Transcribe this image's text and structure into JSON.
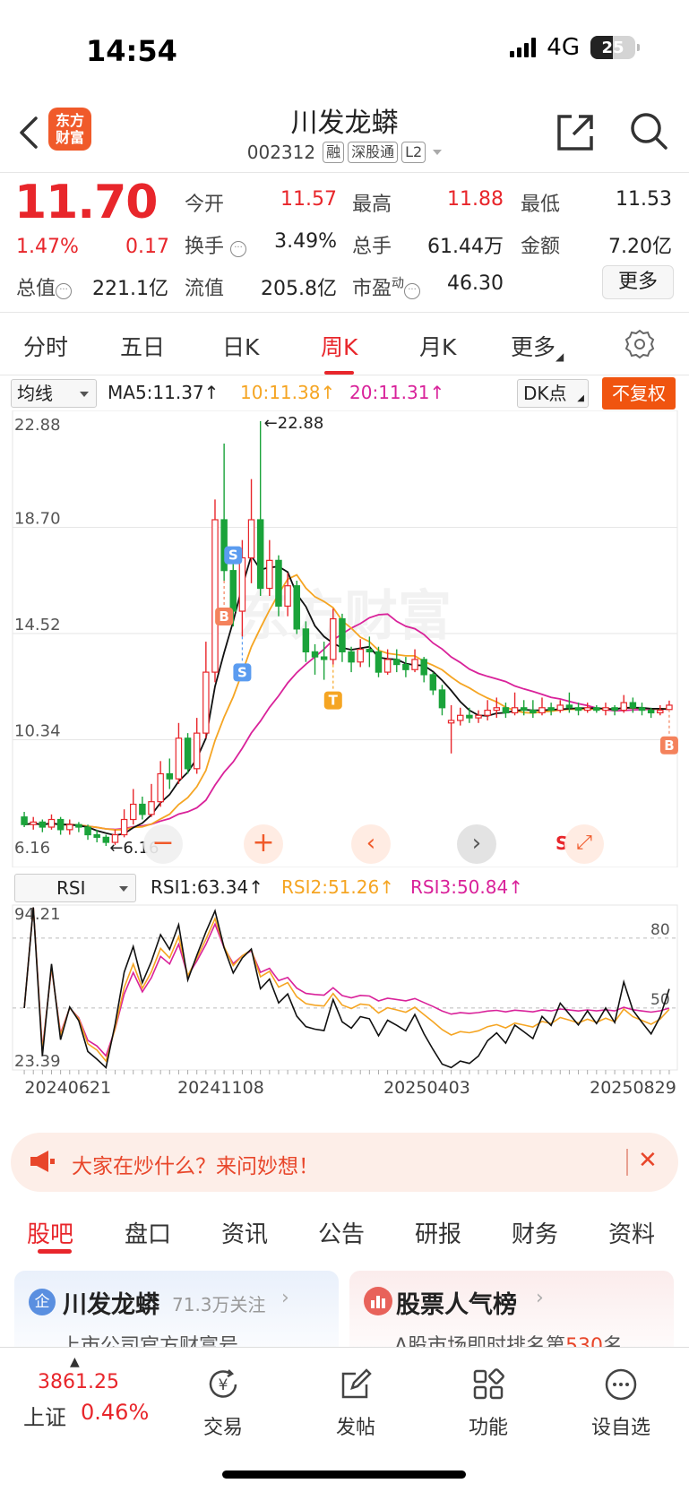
{
  "status_bar": {
    "time": "14:54",
    "network": "4G",
    "battery": "25"
  },
  "header": {
    "logo_line1": "东方",
    "logo_line2": "财富",
    "title": "川发龙蟒",
    "code": "002312",
    "tags": [
      "融",
      "深股通",
      "L2"
    ]
  },
  "quote": {
    "price": "11.70",
    "change_pct": "1.47%",
    "change": "0.17",
    "stats": [
      {
        "label": "今开",
        "value": "11.57",
        "color": "red"
      },
      {
        "label": "最高",
        "value": "11.88",
        "color": "red"
      },
      {
        "label": "最低",
        "value": "11.53",
        "color": "black"
      },
      {
        "label": "换手",
        "value": "3.49%",
        "color": "black"
      },
      {
        "label": "总手",
        "value": "61.44万",
        "color": "black"
      },
      {
        "label": "金额",
        "value": "7.20亿",
        "color": "black"
      },
      {
        "label": "总值",
        "value": "221.1亿",
        "color": "black"
      },
      {
        "label": "流值",
        "value": "205.8亿",
        "color": "black"
      },
      {
        "label": "市盈",
        "label_sup": "动",
        "value": "46.30",
        "color": "black"
      }
    ],
    "more_button": "更多"
  },
  "chart_tabs": [
    "分时",
    "五日",
    "日K",
    "周K",
    "月K",
    "更多"
  ],
  "chart_tab_active": "周K",
  "kline_legend": {
    "indicator_select": "均线",
    "ma5": "MA5:11.37↑",
    "ma10": "10:11.38↑",
    "ma20": "20:11.31↑",
    "dk_select": "DK点",
    "adjust_button": "不复权"
  },
  "rsi_legend": {
    "indicator_select": "RSI",
    "rsi1": "RSI1:63.34↑",
    "rsi2": "RSI2:51.26↑",
    "rsi3": "RSI3:50.84↑"
  },
  "chart_data": [
    {
      "type": "candlestick",
      "y_ticks": [
        "22.88",
        "18.70",
        "14.52",
        "10.34",
        "6.16"
      ],
      "ylim": [
        6.16,
        22.88
      ],
      "max_label": "22.88",
      "min_label": "6.16",
      "markers": [
        "B",
        "S",
        "S",
        "T",
        "B",
        "S"
      ],
      "colors": {
        "up": "#e8262b",
        "down": "#1aa33a",
        "ma5": "#111111",
        "ma10": "#f5a523",
        "ma20": "#d9229a"
      },
      "candles": [
        [
          7.3,
          7.0,
          7.5,
          6.9
        ],
        [
          7.0,
          7.1,
          7.3,
          6.8
        ],
        [
          7.1,
          6.9,
          7.2,
          6.7
        ],
        [
          6.9,
          7.2,
          7.4,
          6.8
        ],
        [
          7.2,
          6.8,
          7.3,
          6.6
        ],
        [
          6.8,
          7.0,
          7.2,
          6.6
        ],
        [
          7.0,
          6.9,
          7.1,
          6.7
        ],
        [
          6.9,
          6.6,
          7.0,
          6.4
        ],
        [
          6.6,
          6.5,
          6.8,
          6.3
        ],
        [
          6.5,
          6.3,
          6.6,
          6.16
        ],
        [
          6.3,
          6.6,
          6.8,
          6.2
        ],
        [
          6.6,
          7.2,
          7.6,
          6.5
        ],
        [
          7.2,
          7.8,
          8.4,
          7.0
        ],
        [
          7.8,
          7.4,
          8.1,
          7.2
        ],
        [
          7.4,
          7.9,
          8.6,
          7.3
        ],
        [
          7.9,
          9.0,
          9.5,
          7.7
        ],
        [
          9.0,
          8.8,
          9.6,
          8.4
        ],
        [
          8.8,
          10.4,
          11.0,
          8.6
        ],
        [
          10.4,
          9.2,
          10.6,
          9.0
        ],
        [
          9.2,
          10.6,
          11.2,
          9.0
        ],
        [
          10.6,
          13.0,
          14.2,
          10.4
        ],
        [
          13.0,
          19.0,
          19.8,
          12.6
        ],
        [
          19.0,
          17.0,
          22.0,
          16.6
        ],
        [
          17.0,
          15.4,
          17.6,
          14.8
        ],
        [
          15.4,
          17.5,
          18.2,
          14.4
        ],
        [
          17.5,
          19.0,
          20.6,
          16.5
        ],
        [
          19.0,
          16.3,
          22.88,
          16.0
        ],
        [
          16.3,
          17.4,
          18.2,
          16.0
        ],
        [
          17.4,
          15.6,
          17.6,
          15.2
        ],
        [
          15.6,
          16.4,
          16.9,
          15.2
        ],
        [
          16.4,
          14.7,
          16.6,
          14.5
        ],
        [
          14.7,
          13.8,
          15.0,
          13.4
        ],
        [
          13.8,
          13.6,
          14.1,
          12.9
        ],
        [
          13.6,
          13.5,
          14.2,
          12.7
        ],
        [
          13.5,
          15.1,
          15.5,
          13.3
        ],
        [
          15.1,
          13.8,
          15.3,
          13.4
        ],
        [
          13.8,
          13.4,
          14.0,
          13.0
        ],
        [
          13.4,
          13.9,
          14.3,
          13.2
        ],
        [
          13.9,
          13.8,
          14.4,
          13.2
        ],
        [
          13.8,
          13.0,
          14.0,
          12.8
        ],
        [
          13.0,
          13.5,
          13.9,
          12.9
        ],
        [
          13.5,
          13.3,
          13.9,
          13.0
        ],
        [
          13.3,
          13.1,
          13.6,
          12.8
        ],
        [
          13.1,
          13.5,
          13.9,
          13.0
        ],
        [
          13.5,
          12.9,
          13.6,
          12.6
        ],
        [
          12.9,
          12.3,
          13.0,
          12.1
        ],
        [
          12.3,
          11.6,
          12.5,
          11.3
        ],
        [
          11.0,
          11.1,
          11.7,
          9.8
        ],
        [
          11.1,
          11.3,
          11.6,
          10.9
        ],
        [
          11.3,
          11.2,
          11.6,
          11.0
        ],
        [
          11.2,
          11.3,
          11.5,
          11.0
        ],
        [
          11.3,
          11.5,
          11.9,
          11.1
        ],
        [
          11.5,
          11.6,
          12.0,
          11.2
        ],
        [
          11.6,
          11.4,
          11.8,
          11.2
        ],
        [
          11.4,
          11.6,
          12.2,
          11.3
        ],
        [
          11.6,
          11.5,
          11.9,
          11.3
        ],
        [
          11.5,
          11.4,
          11.9,
          11.2
        ],
        [
          11.4,
          11.6,
          12.0,
          11.3
        ],
        [
          11.6,
          11.5,
          11.8,
          11.3
        ],
        [
          11.5,
          11.7,
          11.9,
          11.4
        ],
        [
          11.7,
          11.6,
          12.2,
          11.4
        ],
        [
          11.6,
          11.5,
          11.8,
          11.3
        ],
        [
          11.5,
          11.6,
          11.8,
          11.4
        ],
        [
          11.6,
          11.5,
          11.7,
          11.4
        ],
        [
          11.5,
          11.6,
          11.8,
          11.3
        ],
        [
          11.6,
          11.5,
          11.7,
          11.3
        ],
        [
          11.5,
          11.8,
          12.1,
          11.4
        ],
        [
          11.8,
          11.6,
          12.0,
          11.4
        ],
        [
          11.6,
          11.5,
          11.8,
          11.3
        ],
        [
          11.5,
          11.4,
          11.6,
          11.2
        ],
        [
          11.4,
          11.5,
          11.7,
          11.3
        ],
        [
          11.53,
          11.7,
          11.88,
          11.53
        ]
      ]
    },
    {
      "type": "line",
      "name": "RSI",
      "y_ticks": [
        "94.21",
        "23.39"
      ],
      "ylim": [
        23.39,
        94.21
      ],
      "ref_lines": [
        80,
        50
      ],
      "x_ticks": [
        "20240621",
        "20241108",
        "20250403",
        "20250829"
      ]
    }
  ],
  "chart_overlay_buttons": [
    "minus",
    "plus",
    "prev",
    "next",
    "expand"
  ],
  "notice": {
    "text": "大家在炒什么？来问妙想！"
  },
  "bottom_tabs": [
    "股吧",
    "盘口",
    "资讯",
    "公告",
    "研报",
    "财务",
    "资料"
  ],
  "bottom_tab_active": "股吧",
  "cards": [
    {
      "title": "川发龙蟒",
      "badge": "企",
      "follow": "71.3万关注",
      "sub": "上市公司官方财富号"
    },
    {
      "title": "股票人气榜",
      "sub_prefix": "A股市场即时排名第",
      "rank": "530",
      "sub_suffix": "名"
    }
  ],
  "bottom_nav": {
    "index_value": "3861.25",
    "index_name": "上证",
    "index_pct": "0.46%",
    "items": [
      "交易",
      "发帖",
      "功能",
      "设自选"
    ]
  }
}
